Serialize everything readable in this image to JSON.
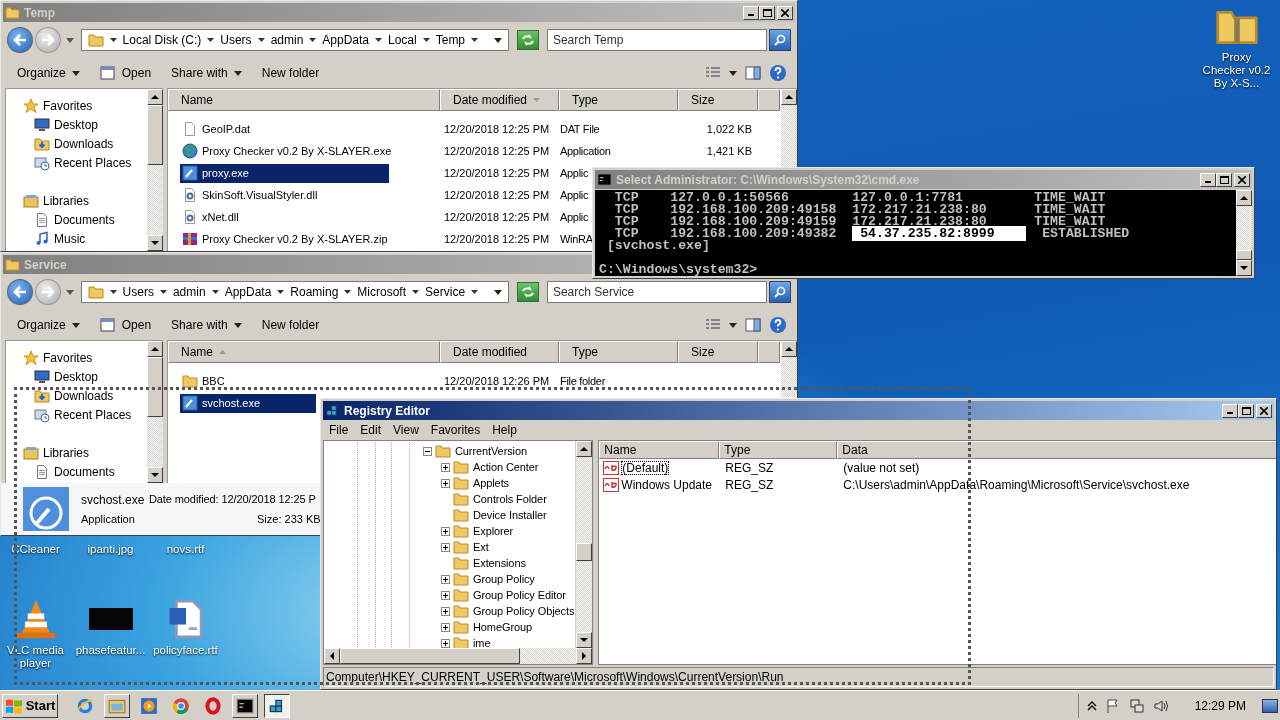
{
  "desktop_top_icon": {
    "label": "Proxy Checker v0.2 By X-S...",
    "kind": "zipfolder"
  },
  "explorers": [
    {
      "title": "Temp",
      "active": false,
      "path": [
        "Local Disk (C:)",
        "Users",
        "admin",
        "AppData",
        "Local",
        "Temp"
      ],
      "search": {
        "placeholder": "Search Temp"
      },
      "toolbar": [
        {
          "label": "Organize",
          "kind": "menu"
        },
        {
          "label": "Open",
          "kind": "open"
        },
        {
          "label": "Share with",
          "kind": "menu"
        },
        {
          "label": "New folder",
          "kind": "plain"
        }
      ],
      "nav": [
        {
          "label": "Favorites",
          "kind": "star"
        },
        {
          "label": "Desktop",
          "kind": "desktop"
        },
        {
          "label": "Downloads",
          "kind": "download"
        },
        {
          "label": "Recent Places",
          "kind": "recent"
        },
        {
          "label": "Libraries",
          "kind": "library"
        },
        {
          "label": "Documents",
          "kind": "document"
        },
        {
          "label": "Music",
          "kind": "music"
        }
      ],
      "columns": [
        {
          "label": "Name",
          "sorted": false
        },
        {
          "label": "Date modified",
          "sorted": true,
          "ascending": false
        },
        {
          "label": "Type",
          "sorted": false
        },
        {
          "label": "Size",
          "sorted": false
        }
      ],
      "rows": [
        {
          "name": "GeoIP.dat",
          "kind": "file",
          "date": "12/20/2018 12:25 PM",
          "type": "DAT File",
          "size": "1,022 KB",
          "selected": false
        },
        {
          "name": "Proxy Checker v0.2 By X-SLAYER.exe",
          "kind": "globe",
          "date": "12/20/2018 12:25 PM",
          "type": "Application",
          "size": "1,421 KB",
          "selected": false
        },
        {
          "name": "proxy.exe",
          "kind": "exe",
          "date": "12/20/2018 12:25 PM",
          "type": "Applic",
          "selected": true
        },
        {
          "name": "SkinSoft.VisualStyler.dll",
          "kind": "dll",
          "date": "12/20/2018 12:25 PM",
          "type": "Applic",
          "selected": false
        },
        {
          "name": "xNet.dll",
          "kind": "dll",
          "date": "12/20/2018 12:25 PM",
          "type": "Applic",
          "selected": false
        },
        {
          "name": "Proxy Checker v0.2 By X-SLAYER.zip",
          "kind": "zip",
          "date": "12/20/2018 12:25 PM",
          "type": "WinRA",
          "selected": false
        }
      ]
    },
    {
      "title": "Service",
      "active": false,
      "path": [
        "Users",
        "admin",
        "AppData",
        "Roaming",
        "Microsoft",
        "Service"
      ],
      "search": {
        "placeholder": "Search Service"
      },
      "toolbar": [
        {
          "label": "Organize",
          "kind": "menu"
        },
        {
          "label": "Open",
          "kind": "open"
        },
        {
          "label": "Share with",
          "kind": "menu"
        },
        {
          "label": "New folder",
          "kind": "plain"
        }
      ],
      "nav": [
        {
          "label": "Favorites",
          "kind": "star"
        },
        {
          "label": "Desktop",
          "kind": "desktop"
        },
        {
          "label": "Downloads",
          "kind": "download"
        },
        {
          "label": "Recent Places",
          "kind": "recent"
        },
        {
          "label": "Libraries",
          "kind": "library"
        },
        {
          "label": "Documents",
          "kind": "document"
        }
      ],
      "columns": [
        {
          "label": "Name",
          "sorted": true,
          "ascending": true
        },
        {
          "label": "Date modified",
          "sorted": false
        },
        {
          "label": "Type",
          "sorted": false
        },
        {
          "label": "Size",
          "sorted": false
        }
      ],
      "rows": [
        {
          "name": "BBC",
          "kind": "folder",
          "date": "12/20/2018 12:26 PM",
          "type": "File folder",
          "selected": false
        },
        {
          "name": "svchost.exe",
          "kind": "exe",
          "selected": true
        }
      ],
      "details": {
        "name": "svchost.exe",
        "modified": "Date modified: 12/20/2018 12:25 P",
        "type": "Application",
        "size": "Size: 233 KB"
      }
    }
  ],
  "desktop_icons": [
    {
      "label": "CCleaner"
    },
    {
      "label": "ipanti.jpg"
    },
    {
      "label": "novs.rtf"
    },
    {
      "label": "VLC media player",
      "kind": "vlc"
    },
    {
      "label": "phasefeatur...",
      "kind": "image"
    },
    {
      "label": "policyface.rtf",
      "kind": "word"
    }
  ],
  "cmd": {
    "title": "Select Administrator: C:\\Windows\\System32\\cmd.exe",
    "active": false,
    "lines": [
      [
        {
          "text": "  TCP    127.0.0.1:50566        127.0.0.1:7781         TIME_WAIT",
          "selected": false
        }
      ],
      [
        {
          "text": "  TCP    192.168.100.209:49158  172.217.21.238:80      TIME_WAIT",
          "selected": false
        }
      ],
      [
        {
          "text": "  TCP    192.168.100.209:49159  172.217.21.238:80      TIME_WAIT",
          "selected": false
        }
      ],
      [
        {
          "text": "  TCP    192.168.100.209:49382  ",
          "selected": false
        },
        {
          "text": " 54.37.235.82:8999    ",
          "selected": true
        },
        {
          "text": "  ESTABLISHED",
          "selected": false
        }
      ],
      [
        {
          "text": " [svchost.exe]",
          "selected": false
        }
      ]
    ],
    "prompt": "C:\\Windows\\system32>"
  },
  "registry": {
    "title": "Registry Editor",
    "active": true,
    "menu": [
      "File",
      "Edit",
      "View",
      "Favorites",
      "Help"
    ],
    "tree": {
      "label": "CurrentVersion",
      "expanded": true,
      "children": [
        {
          "label": "Action Center",
          "expandable": true
        },
        {
          "label": "Applets",
          "expandable": true
        },
        {
          "label": "Controls Folder",
          "expandable": false
        },
        {
          "label": "Device Installer",
          "expandable": false
        },
        {
          "label": "Explorer",
          "expandable": true
        },
        {
          "label": "Ext",
          "expandable": true
        },
        {
          "label": "Extensions",
          "expandable": false
        },
        {
          "label": "Group Policy",
          "expandable": true
        },
        {
          "label": "Group Policy Editor",
          "expandable": true
        },
        {
          "label": "Group Policy Objects",
          "expandable": true
        },
        {
          "label": "HomeGroup",
          "expandable": true
        },
        {
          "label": "ime",
          "expandable": true
        }
      ]
    },
    "columns": [
      "Name",
      "Type",
      "Data"
    ],
    "values": [
      {
        "name": "(Default)",
        "type": "REG_SZ",
        "data": "(value not set)",
        "focused": true
      },
      {
        "name": "Windows Update",
        "type": "REG_SZ",
        "data": "C:\\Users\\admin\\AppData\\Roaming\\Microsoft\\Service\\svchost.exe",
        "focused": false
      }
    ],
    "status": "Computer\\HKEY_CURRENT_USER\\Software\\Microsoft\\Windows\\CurrentVersion\\Run"
  },
  "taskbar": {
    "start": "Start",
    "apps": [
      {
        "kind": "ie",
        "selected": false
      },
      {
        "kind": "explorer",
        "selected": false
      },
      {
        "kind": "media",
        "selected": false
      },
      {
        "kind": "chrome",
        "selected": false
      },
      {
        "kind": "opera",
        "selected": false
      },
      {
        "kind": "cmd",
        "selected": false
      },
      {
        "kind": "regedit",
        "selected": true
      }
    ],
    "time": "12:29 PM"
  }
}
